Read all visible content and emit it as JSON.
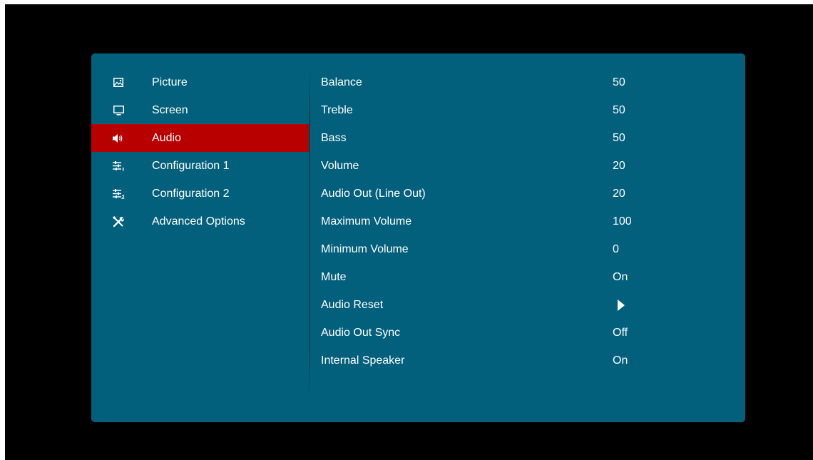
{
  "menu": {
    "sidebar": {
      "items": [
        {
          "label": "Picture",
          "icon": "picture-icon",
          "active": false
        },
        {
          "label": "Screen",
          "icon": "screen-icon",
          "active": false
        },
        {
          "label": "Audio",
          "icon": "speaker-icon",
          "active": true
        },
        {
          "label": "Configuration 1",
          "icon": "sliders-1-icon",
          "active": false
        },
        {
          "label": "Configuration 2",
          "icon": "sliders-2-icon",
          "active": false
        },
        {
          "label": "Advanced Options",
          "icon": "tools-icon",
          "active": false
        }
      ]
    },
    "settings": [
      {
        "label": "Balance",
        "value": "50"
      },
      {
        "label": "Treble",
        "value": "50"
      },
      {
        "label": "Bass",
        "value": "50"
      },
      {
        "label": "Volume",
        "value": "20"
      },
      {
        "label": "Audio Out (Line Out)",
        "value": "20"
      },
      {
        "label": "Maximum Volume",
        "value": "100"
      },
      {
        "label": "Minimum Volume",
        "value": "0"
      },
      {
        "label": "Mute",
        "value": "On"
      },
      {
        "label": "Audio Reset",
        "value": "",
        "icon": "arrow-right-icon"
      },
      {
        "label": "Audio Out Sync",
        "value": "Off"
      },
      {
        "label": "Internal Speaker",
        "value": "On"
      }
    ]
  },
  "colors": {
    "screen_background": "#000000",
    "panel_background": "#02607c",
    "active_item_background": "#b90000",
    "text": "#ffffff"
  }
}
